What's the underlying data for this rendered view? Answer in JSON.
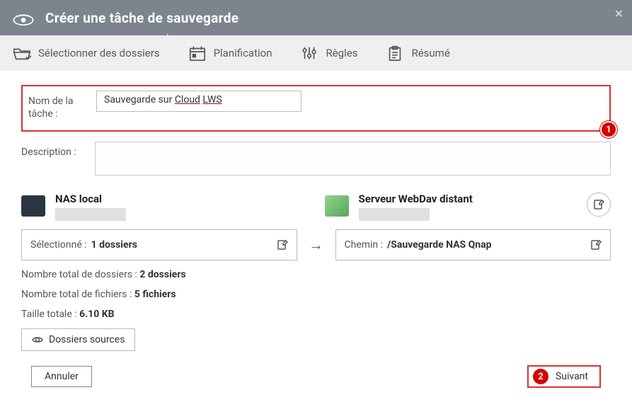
{
  "titlebar": {
    "title": "Créer une tâche de sauvegarde"
  },
  "tabs": [
    {
      "label": "Sélectionner des dossiers"
    },
    {
      "label": "Planification"
    },
    {
      "label": "Règles"
    },
    {
      "label": "Résumé"
    }
  ],
  "task_name": {
    "label": "Nom de la tâche :",
    "value_prefix": "Sauvegarde sur ",
    "value_underlined1": "Cloud",
    "value_mid": " ",
    "value_underlined2": "LWS"
  },
  "description": {
    "label": "Description :"
  },
  "source": {
    "name": "NAS local",
    "selected_label": "Sélectionné : ",
    "selected_value": "1 dossiers"
  },
  "destination": {
    "name": "Serveur WebDav distant",
    "path_label": "Chemin : ",
    "path_value": "/Sauvegarde NAS Qnap"
  },
  "stats": {
    "folders_label": "Nombre total de dossiers : ",
    "folders_value": "2 dossiers",
    "files_label": "Nombre total de fichiers : ",
    "files_value": "5 fichiers",
    "size_label": "Taille totale : ",
    "size_value": "6.10 KB"
  },
  "source_folders_btn": "Dossiers sources",
  "footer": {
    "cancel": "Annuler",
    "next": "Suivant"
  },
  "badges": {
    "one": "1",
    "two": "2"
  }
}
